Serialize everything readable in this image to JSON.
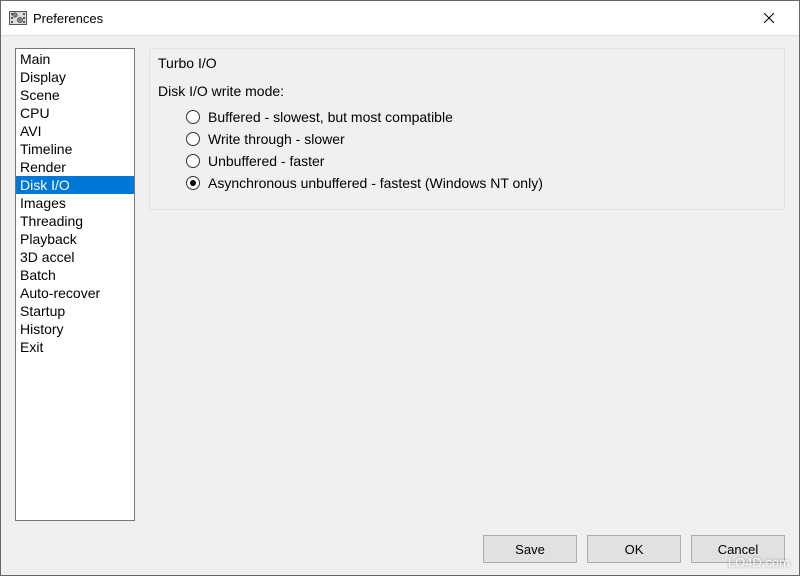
{
  "window": {
    "title": "Preferences"
  },
  "sidebar": {
    "items": [
      {
        "label": "Main"
      },
      {
        "label": "Display"
      },
      {
        "label": "Scene"
      },
      {
        "label": "CPU"
      },
      {
        "label": "AVI"
      },
      {
        "label": "Timeline"
      },
      {
        "label": "Render"
      },
      {
        "label": "Disk I/O"
      },
      {
        "label": "Images"
      },
      {
        "label": "Threading"
      },
      {
        "label": "Playback"
      },
      {
        "label": "3D accel"
      },
      {
        "label": "Batch"
      },
      {
        "label": "Auto-recover"
      },
      {
        "label": "Startup"
      },
      {
        "label": "History"
      },
      {
        "label": "Exit"
      }
    ],
    "selected_index": 7
  },
  "panel": {
    "heading": "Turbo I/O",
    "subheading": "Disk I/O write mode:",
    "options": [
      {
        "label": "Buffered - slowest, but most compatible"
      },
      {
        "label": "Write through - slower"
      },
      {
        "label": "Unbuffered - faster"
      },
      {
        "label": "Asynchronous unbuffered - fastest (Windows NT only)"
      }
    ],
    "selected_index": 3
  },
  "buttons": {
    "save": "Save",
    "ok": "OK",
    "cancel": "Cancel"
  },
  "watermark": "LO4D.com"
}
